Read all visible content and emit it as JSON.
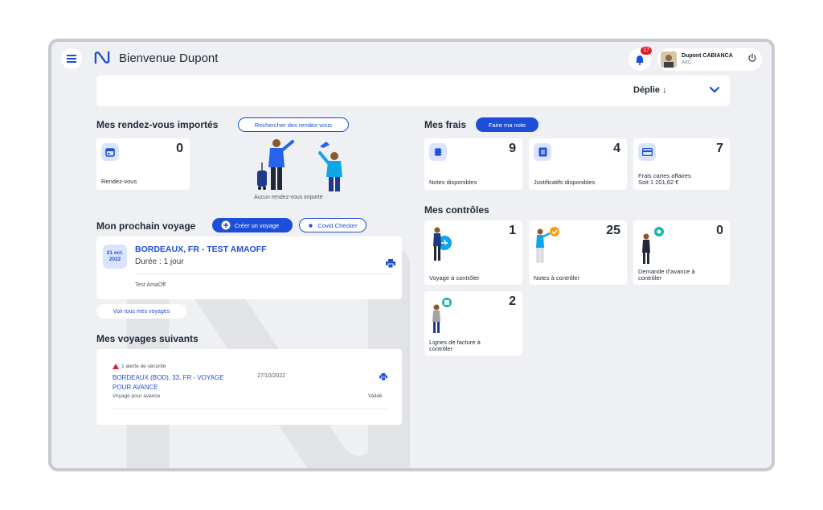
{
  "header": {
    "welcome": "Bienvenue Dupont",
    "notifications_count": "17",
    "user_name": "Dupont CABIANCA",
    "user_company": "AXC"
  },
  "deplie": {
    "label": "Déplie ↓"
  },
  "rdv": {
    "title": "Mes rendez-vous importés",
    "search_button": "Rechercher des rendez-vous",
    "count": "0",
    "label": "Rendez-vous",
    "empty_text": "Aucun rendez-vous importé"
  },
  "prochain": {
    "title": "Mon prochain voyage",
    "create_button": "Créer un voyage",
    "covid_button": "Covid Checker",
    "date_line1": "21 oct.",
    "date_line2": "2022",
    "trip_title": "BORDEAUX, FR - TEST AMAOFF",
    "duration": "Durée : 1 jour",
    "note": "Test AmaOff",
    "see_all": "Voir tous mes voyages"
  },
  "suivants": {
    "title": "Mes voyages suivants",
    "alert": "1 alerte de sécurité",
    "trip_line1": "BORDEAUX (BOD), 33, FR - VOYAGE",
    "trip_line2": "POUR AVANCE",
    "date": "27/10/2022",
    "type": "Voyage pour avance",
    "status": "Validé"
  },
  "frais": {
    "title": "Mes frais",
    "button": "Faire ma note",
    "cards": [
      {
        "count": "9",
        "label": "Notes disponibles"
      },
      {
        "count": "4",
        "label": "Justificatifs disponibles"
      },
      {
        "count": "7",
        "label": "Frais cartes affaires",
        "sub": "Soit 1 201,62 €"
      }
    ]
  },
  "controles": {
    "title": "Mes contrôles",
    "cards": [
      {
        "count": "1",
        "label": "Voyage à contrôler"
      },
      {
        "count": "25",
        "label": "Notes à contrôler"
      },
      {
        "count": "0",
        "label": "Demande d'avance à",
        "label2": "contrôler"
      },
      {
        "count": "2",
        "label": "Lignes de facture à",
        "label2": "contrôler"
      }
    ]
  },
  "colors": {
    "primary": "#1d4ed8",
    "icon_bg": "#dbe4ff",
    "frame_bg": "#eef0f3",
    "alert": "#e11d2a"
  }
}
